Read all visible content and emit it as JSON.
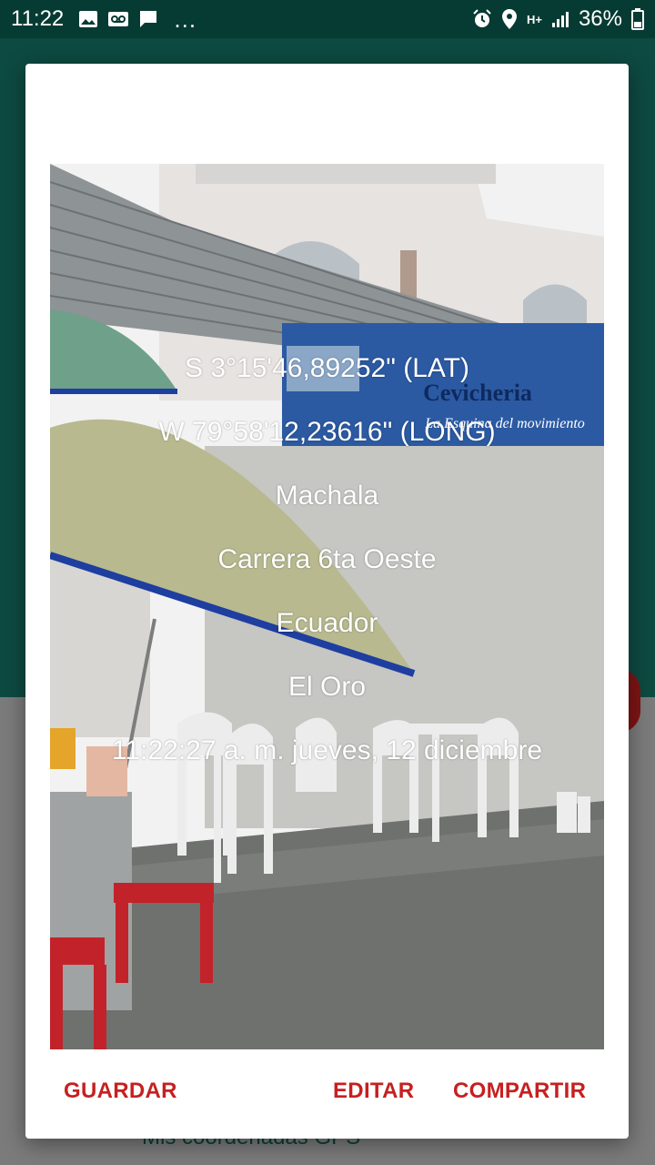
{
  "status_bar": {
    "time": "11:22",
    "overflow": "…",
    "net_type": "H+",
    "battery": "36%",
    "icons": [
      "image-icon",
      "voicemail-icon",
      "message-icon",
      "alarm-icon",
      "location-icon",
      "signal-icon",
      "battery-icon"
    ]
  },
  "background": {
    "list_item_text": "Mis coordenadas GPS"
  },
  "dialog": {
    "photo_overlay": {
      "latitude": "S 3°15'46,89252\" (LAT)",
      "longitude": "W 79°58'12,23616\" (LONG)",
      "city": "Machala",
      "street": "Carrera 6ta Oeste",
      "country": "Ecuador",
      "province": "El Oro",
      "datetime": "11:22:27 a. m. jueves, 12 diciembre"
    },
    "photo_sign_text": {
      "line1": "Cevicheria",
      "line2": "La Esquina del movimiento"
    },
    "buttons": {
      "save": "GUARDAR",
      "edit": "EDITAR",
      "share": "COMPARTIR"
    }
  },
  "colors": {
    "accent": "#c62020",
    "status_bar": "#063b33",
    "app_primary": "#0d4a41"
  }
}
